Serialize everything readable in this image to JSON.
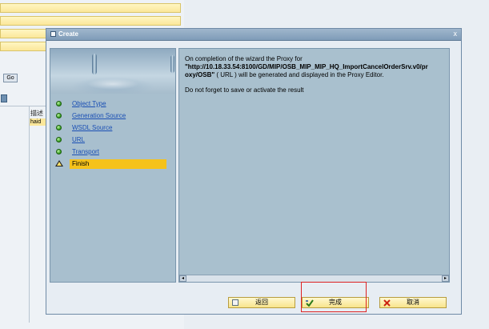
{
  "background": {
    "button_label": "Go",
    "column_header": "描述",
    "row_value": "haid"
  },
  "dialog": {
    "title": "Create",
    "close_symbol": "x"
  },
  "steps": [
    {
      "label": "Object Type",
      "state": "done"
    },
    {
      "label": "Generation Source",
      "state": "done"
    },
    {
      "label": "WSDL Source",
      "state": "done"
    },
    {
      "label": "URL",
      "state": "done"
    },
    {
      "label": "Transport",
      "state": "done"
    },
    {
      "label": "Finish",
      "state": "current"
    }
  ],
  "message": {
    "line1": "On completion of the wizard the Proxy for",
    "path_part1": "\"http://10.18.33.54:8100/GD/MIP/OSB_MIP_MIP_HQ_ImportCancelOrderSrv.v0/pr",
    "path_part2": "oxy/OSB\"",
    "url_tag": " ( URL ) will be generated and displayed in the Proxy Editor.",
    "reminder": "Do not forget to save or activate the result"
  },
  "buttons": {
    "back_label": "返回",
    "finish_label": "完成",
    "cancel_label": "取消"
  },
  "colors": {
    "accent": "#f5c21b",
    "step_done": "#2f9a1a",
    "link": "#1a4fb4",
    "highlight_box": "#dd2222"
  },
  "icons": {
    "back": "back-page-icon",
    "finish": "check-icon",
    "cancel": "cancel-x-icon"
  }
}
